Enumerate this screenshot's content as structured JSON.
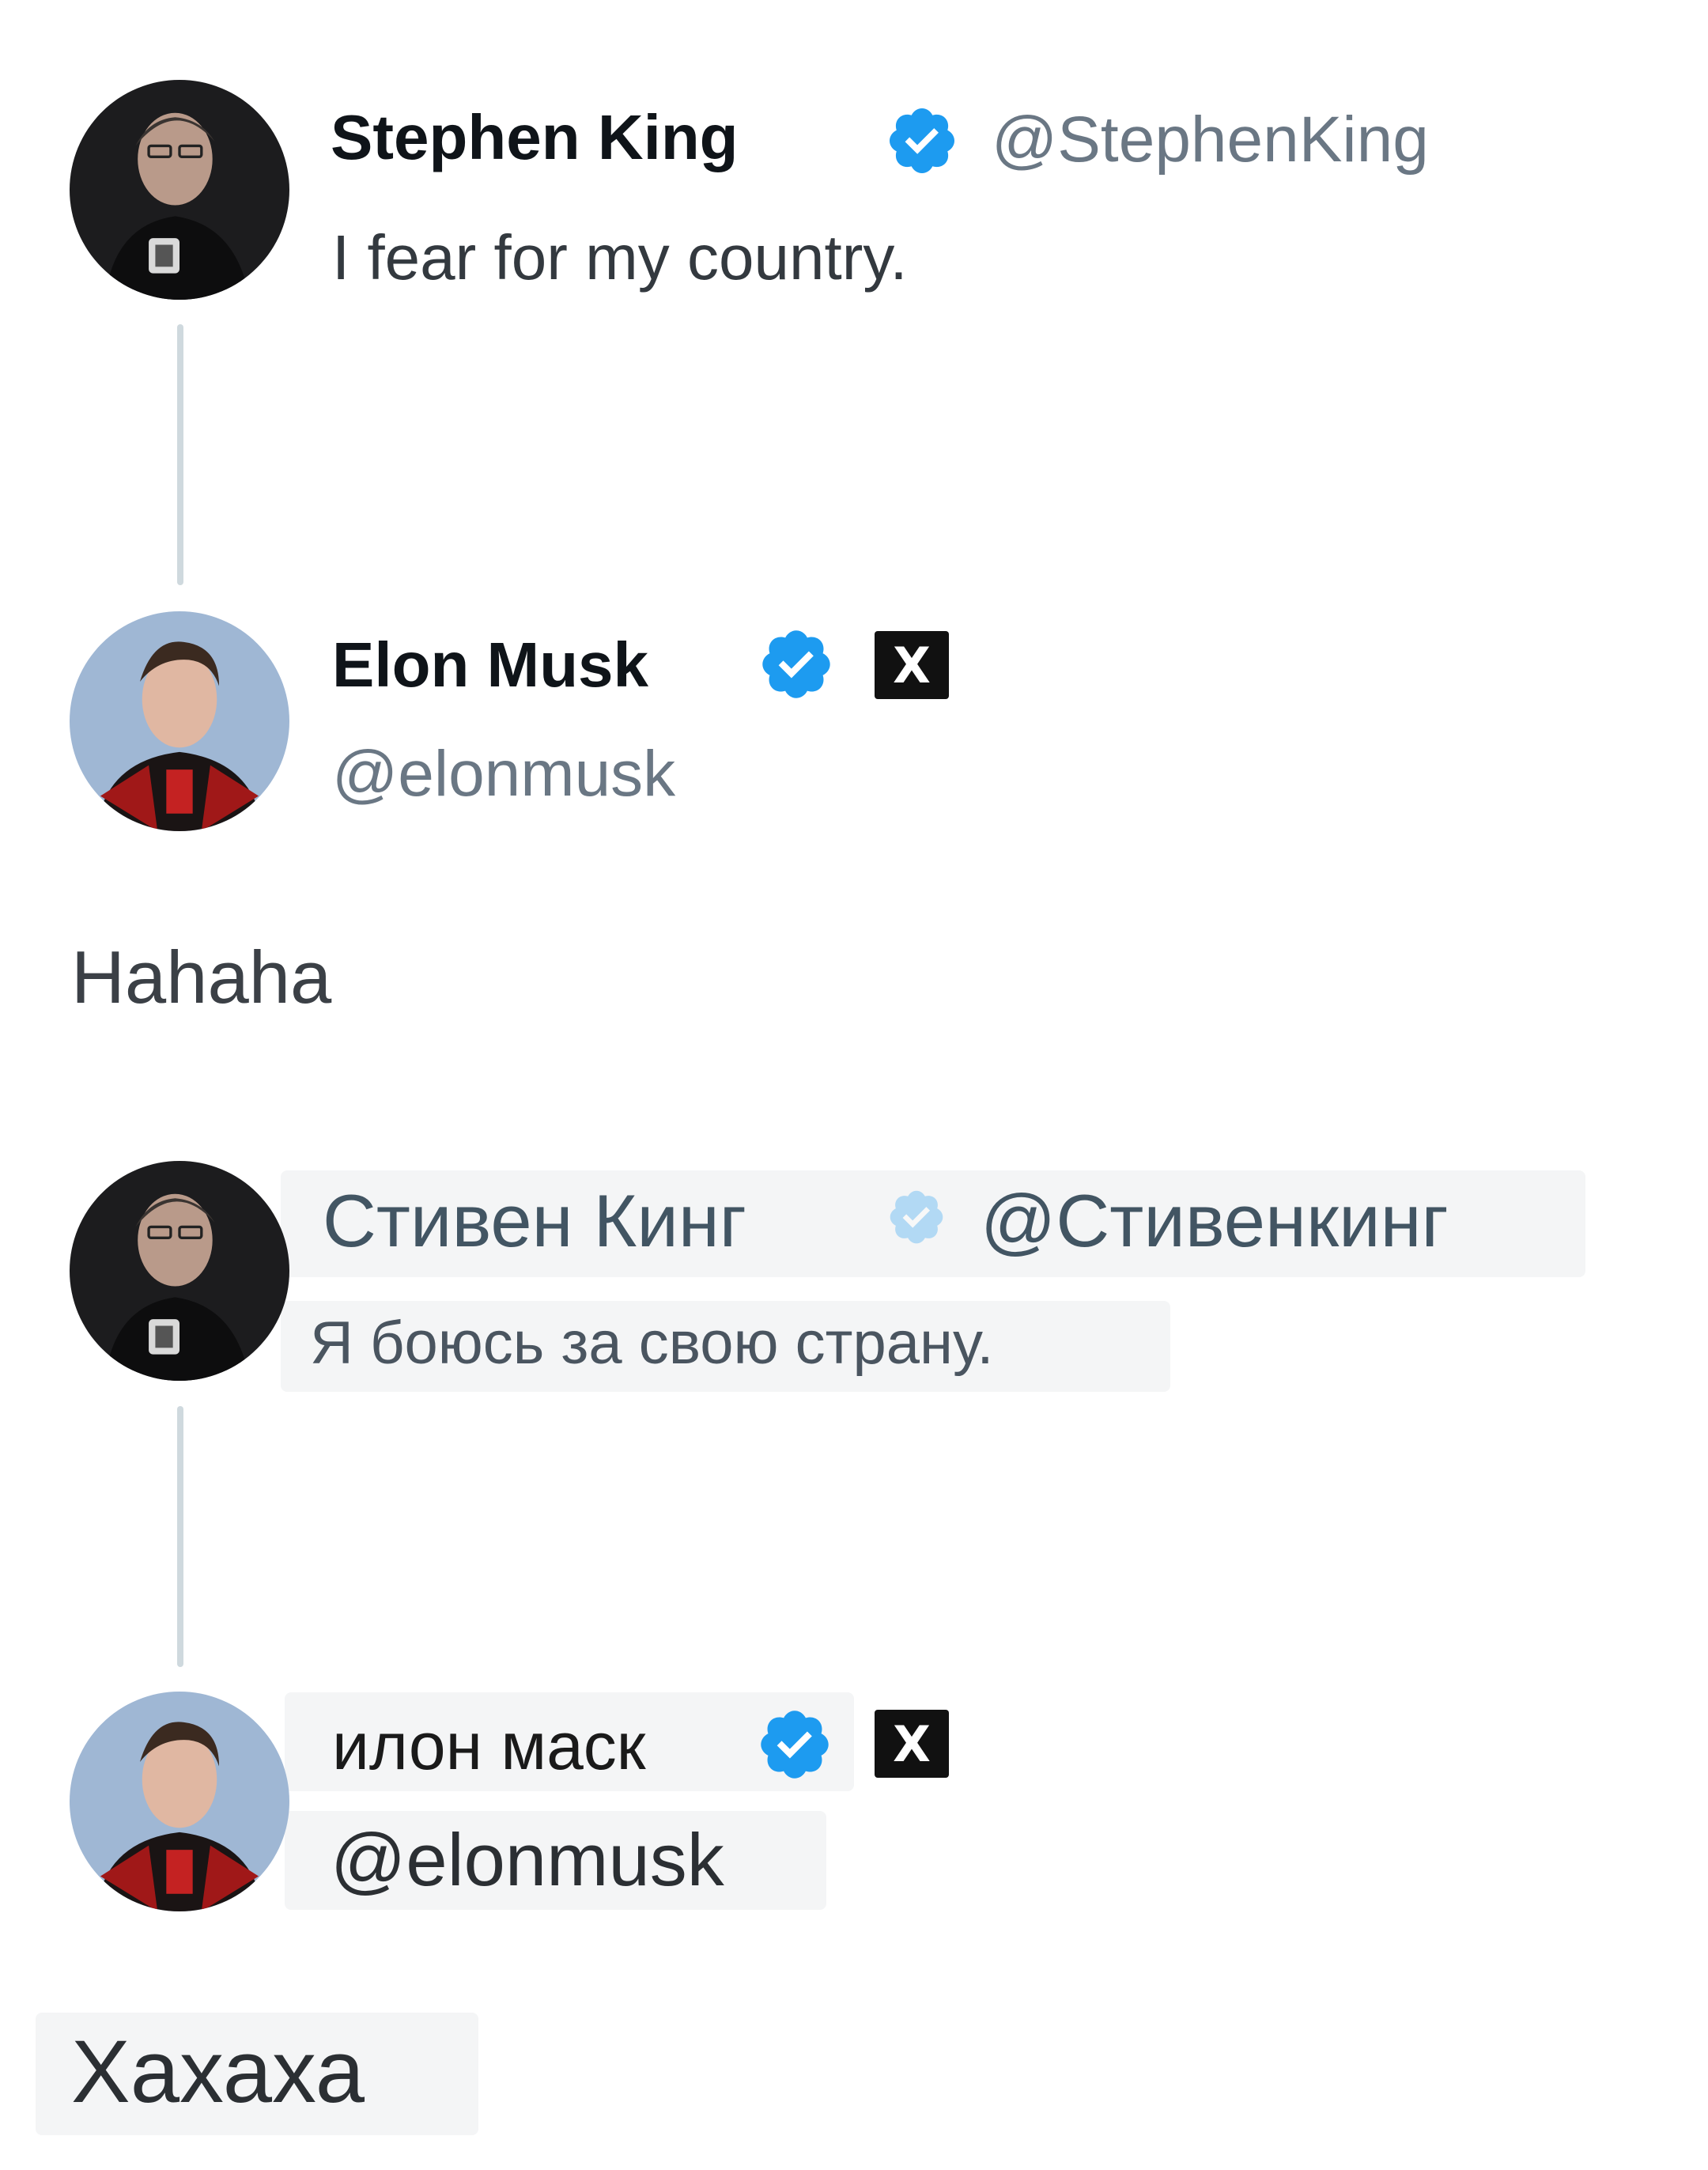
{
  "colors": {
    "verified": "#1d9bf0",
    "thread_line": "#cfd9de",
    "handle": "#6a7784",
    "text": "#0f1419"
  },
  "original": {
    "tweet": {
      "author_name": "Stephen King",
      "author_handle": "@StephenKing",
      "verified_icon": "verified-badge-icon",
      "text": "I fear for my country."
    },
    "reply": {
      "author_name": "Elon Musk",
      "author_handle": "@elonmusk",
      "verified_icon": "verified-badge-icon",
      "affiliate_icon": "x-logo-icon",
      "affiliate_label": "X",
      "text": "Hahaha"
    }
  },
  "translated": {
    "tweet": {
      "author_name": "Стивен Кинг",
      "author_handle": "@Стивенкинг",
      "verified_icon": "verified-badge-icon",
      "text": "Я боюсь за свою страну."
    },
    "reply": {
      "author_name": "илон маск",
      "author_handle": "@elonmusk",
      "verified_icon": "verified-badge-icon",
      "affiliate_icon": "x-logo-icon",
      "affiliate_label": "X",
      "text": "Хахаха"
    }
  }
}
